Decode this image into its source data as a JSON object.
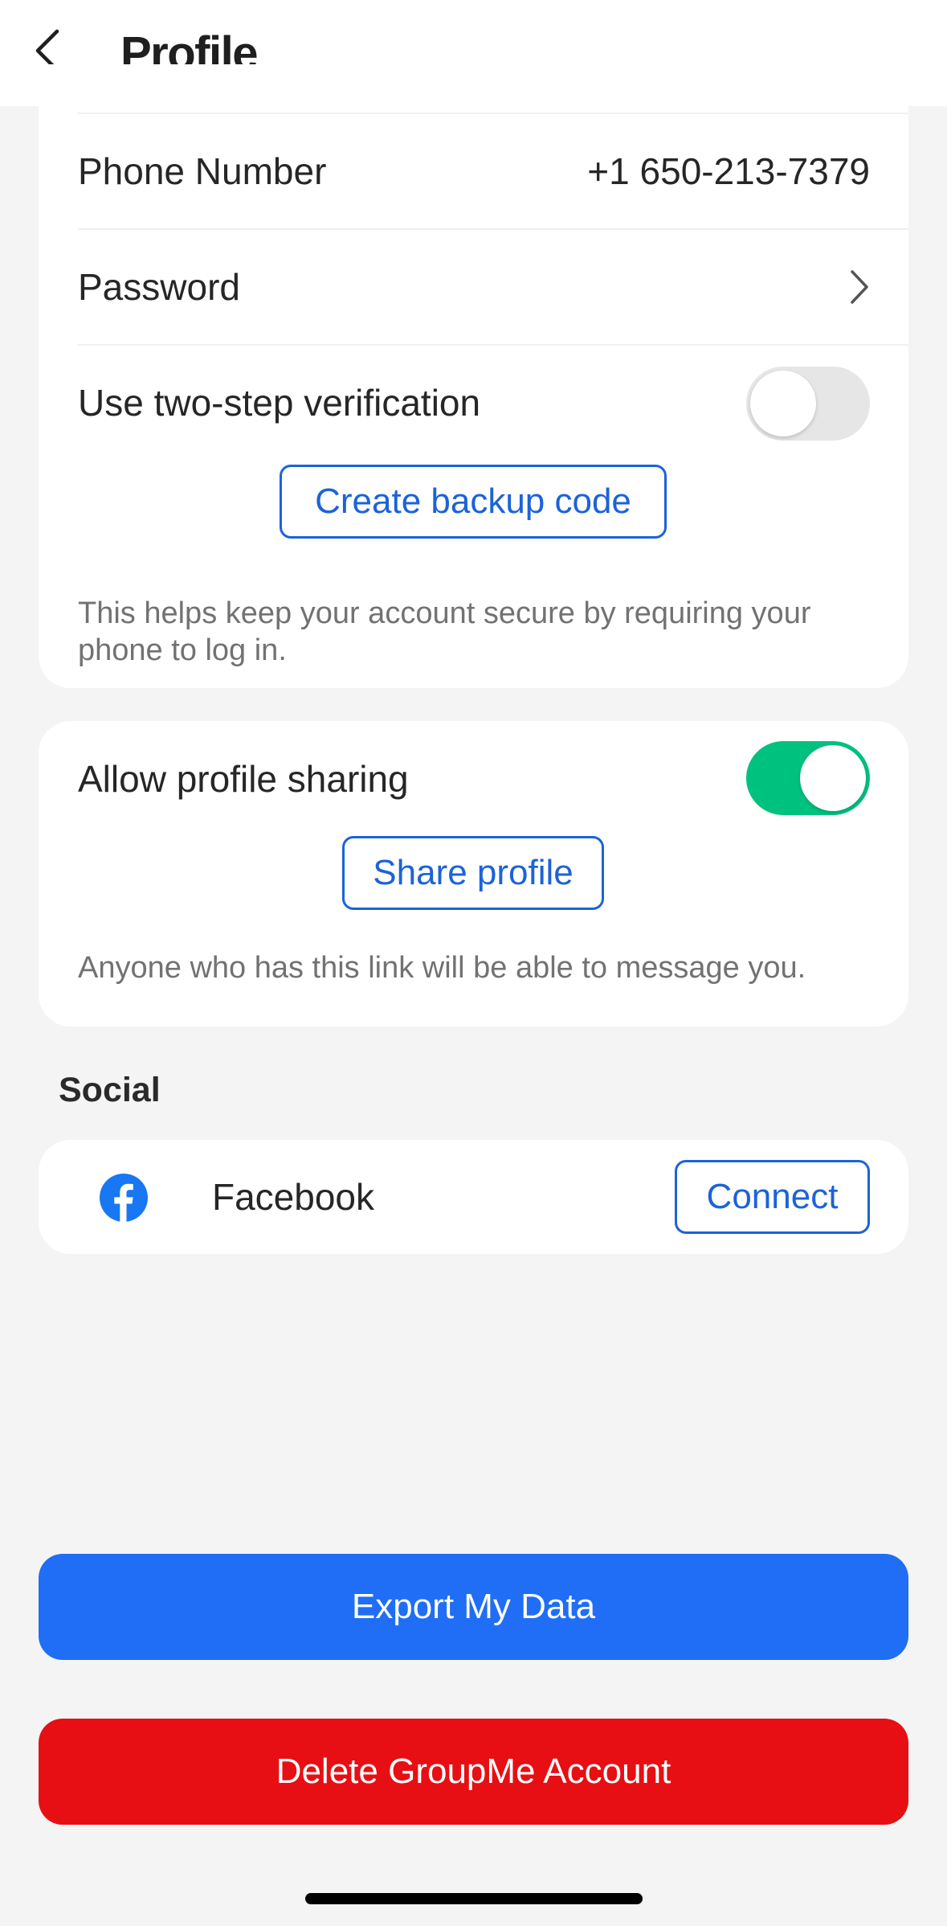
{
  "header": {
    "title": "Profile"
  },
  "account": {
    "phone_label": "Phone Number",
    "phone_value": "+1 650-213-7379",
    "password_label": "Password",
    "two_step_label": "Use two-step verification",
    "two_step_enabled": false,
    "backup_button": "Create backup code",
    "two_step_help": "This helps keep your account secure by requiring your phone to log in."
  },
  "sharing": {
    "label": "Allow profile sharing",
    "enabled": true,
    "share_button": "Share profile",
    "help": "Anyone who has this link will be able to message you."
  },
  "social": {
    "title": "Social",
    "items": [
      {
        "name": "Facebook",
        "icon": "facebook-icon",
        "action": "Connect"
      }
    ]
  },
  "actions": {
    "export": "Export My Data",
    "delete": "Delete GroupMe Account"
  },
  "colors": {
    "accent": "#1b63d9",
    "primary_button": "#1f6ef5",
    "danger_button": "#e70f13",
    "toggle_on": "#00c27f",
    "facebook": "#1877f2"
  }
}
